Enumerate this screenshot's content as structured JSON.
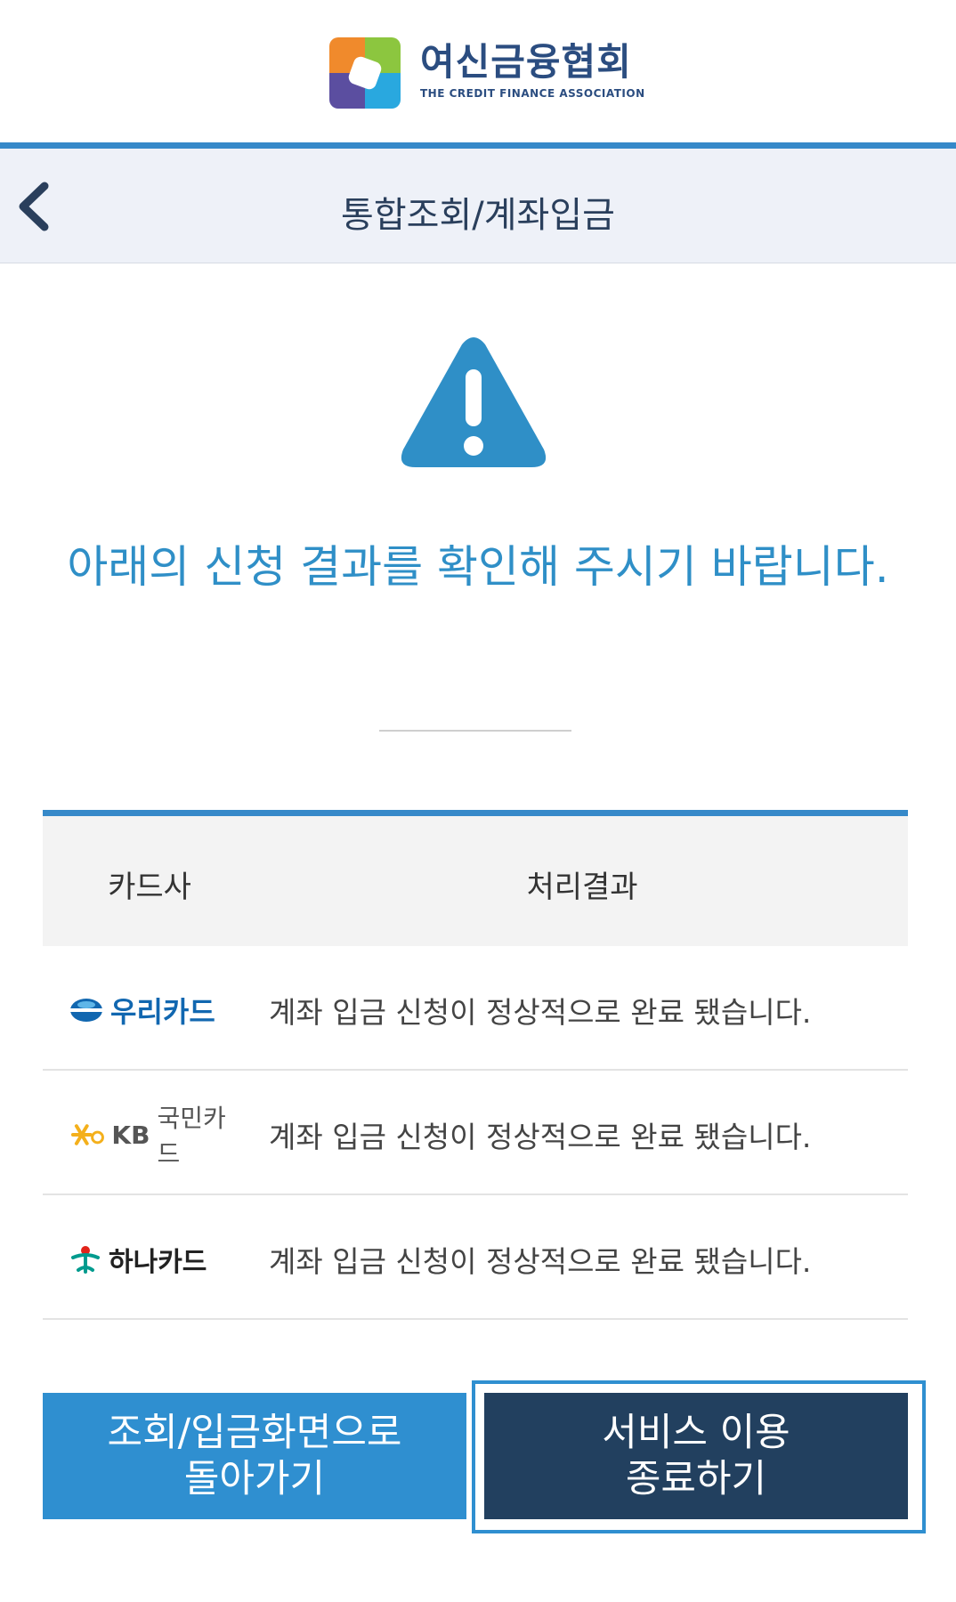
{
  "header": {
    "org_name": "여신금융협회",
    "org_name_en": "THE CREDIT FINANCE ASSOCIATION"
  },
  "title_bar": {
    "title": "통합조회/계좌입금"
  },
  "alert": {
    "message": "아래의 신청 결과를 확인해 주시기 바랍니다."
  },
  "table": {
    "headers": {
      "card_company": "카드사",
      "result": "처리결과"
    },
    "rows": [
      {
        "card": "우리카드",
        "result": "계좌 입금 신청이 정상적으로 완료 됐습니다."
      },
      {
        "card_en": "KB",
        "card": "국민카드",
        "result": "계좌 입금 신청이 정상적으로 완료 됐습니다."
      },
      {
        "card": "하나카드",
        "result": "계좌 입금 신청이 정상적으로 완료 됐습니다."
      }
    ]
  },
  "buttons": {
    "back_line1": "조회/입금화면으로",
    "back_line2": "돌아가기",
    "exit_line1": "서비스 이용",
    "exit_line2": "종료하기"
  },
  "colors": {
    "accent": "#2f8fd0",
    "title_bg": "#eef1f8",
    "dark_button": "#22405f",
    "alert_text": "#2f8fc7"
  }
}
